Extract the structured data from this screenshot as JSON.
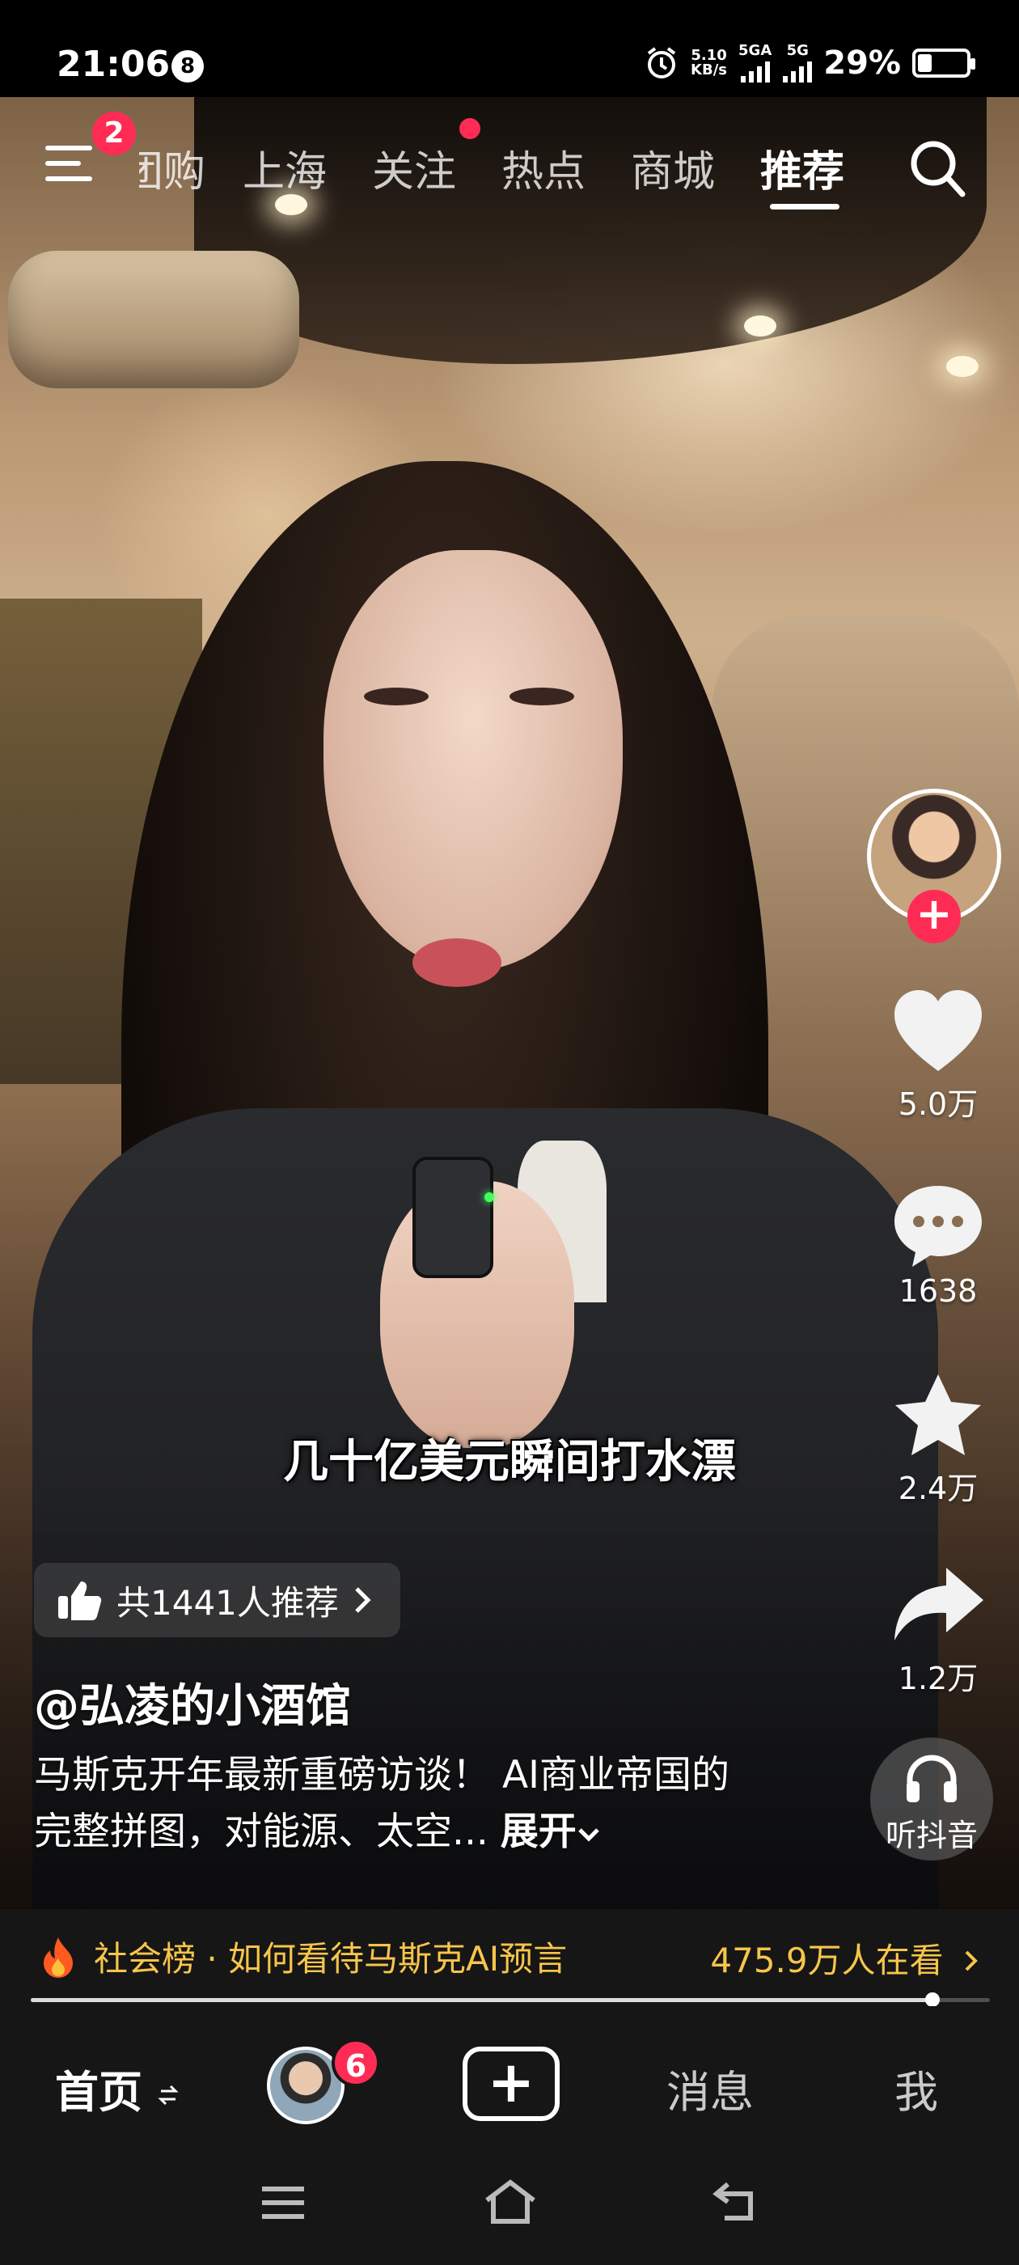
{
  "status_bar": {
    "time": "21:06",
    "notification_count": "8",
    "network_speed_value": "5.10",
    "network_speed_unit": "KB/s",
    "sim1_label": "5GA",
    "sim2_label": "5G",
    "battery_percent": "29%",
    "battery_level": 0.29
  },
  "top_nav": {
    "menu_badge": "2",
    "tabs": [
      "团购",
      "上海",
      "关注",
      "热点",
      "商城",
      "推荐"
    ],
    "active_tab": "推荐"
  },
  "video": {
    "subtitle": "几十亿美元瞬间打水漂",
    "recommend_chip": "共1441人推荐",
    "author": "@弘凌的小酒馆",
    "description": "马斯克开年最新重磅访谈！ AI商业帝国的完整拼图，对能源、太空...",
    "expand_label": "展开"
  },
  "right_rail": {
    "likes": "5.0万",
    "comments": "1638",
    "favorites": "2.4万",
    "shares": "1.2万",
    "listen_label": "听抖音"
  },
  "hot_bar": {
    "left_text": "社会榜 · 如何看待马斯克AI预言",
    "right_text": "475.9万人在看"
  },
  "progress": 0.94,
  "bottom_nav": {
    "home": "首页",
    "friends_badge": "6",
    "messages": "消息",
    "me": "我"
  },
  "colors": {
    "accent": "#fe2c55",
    "hot_text": "#f7c54a",
    "bar_bg": "#161616"
  }
}
